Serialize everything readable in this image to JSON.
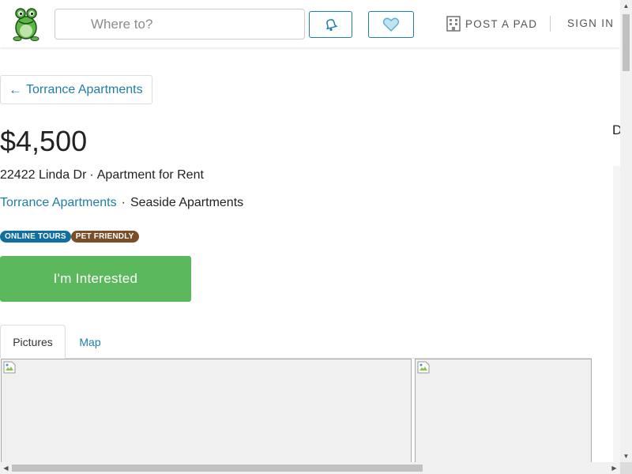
{
  "header": {
    "search_placeholder": "Where to?",
    "post_pad_label": "POST A PAD",
    "sign_in_label": "SIGN IN",
    "accent_color": "#1d7fa8"
  },
  "back_link": {
    "arrow": "←",
    "label": "Torrance Apartments"
  },
  "listing": {
    "price": "$4,500",
    "address": "22422 Linda Dr",
    "separator": "·",
    "type": "Apartment for Rent",
    "city_link": "Torrance Apartments",
    "complex_name": "Seaside Apartments",
    "badges": [
      "ONLINE TOURS",
      "PET FRIENDLY"
    ]
  },
  "cta": {
    "label": "I'm Interested",
    "color": "#5cb85c"
  },
  "tabs": [
    {
      "label": "Pictures",
      "active": true
    },
    {
      "label": "Map",
      "active": false
    }
  ],
  "right_edge": {
    "letter": "D"
  },
  "icons": [
    "frog-logo-icon",
    "bell-icon",
    "heart-icon",
    "building-icon",
    "broken-image-icon"
  ]
}
